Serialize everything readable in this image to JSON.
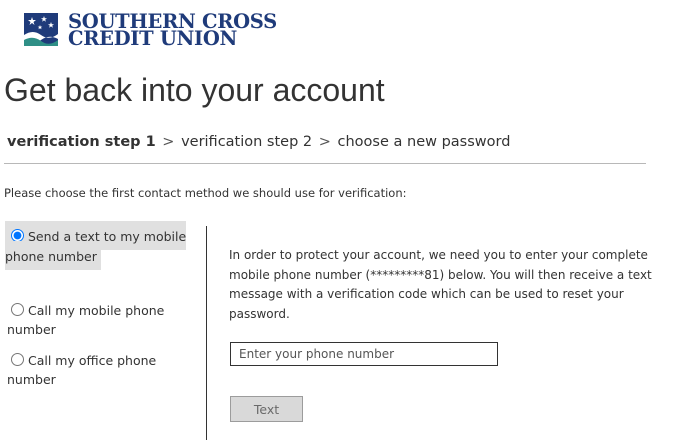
{
  "brand": {
    "line1": "SOUTHERN CROSS",
    "line2": "CREDIT UNION",
    "color": "#1f3b7a",
    "icon": "southern-cross-logo"
  },
  "page_title": "Get back into your account",
  "breadcrumb": {
    "steps": [
      "verification step 1",
      "verification step 2",
      "choose a new password"
    ],
    "separator": ">"
  },
  "instruction": "Please choose the first contact method we should use for verification:",
  "methods": [
    {
      "label": "Send a text to my mobile phone number",
      "selected": true
    },
    {
      "label": "Call my mobile phone number",
      "selected": false
    },
    {
      "label": "Call my office phone number",
      "selected": false
    }
  ],
  "info_text": "In order to protect your account, we need you to enter your complete mobile phone number (*********81) below. You will then receive a text message with a verification code which can be used to reset your password.",
  "phone_input": {
    "placeholder": "Enter your phone number",
    "value": ""
  },
  "submit_button": {
    "label": "Text"
  }
}
